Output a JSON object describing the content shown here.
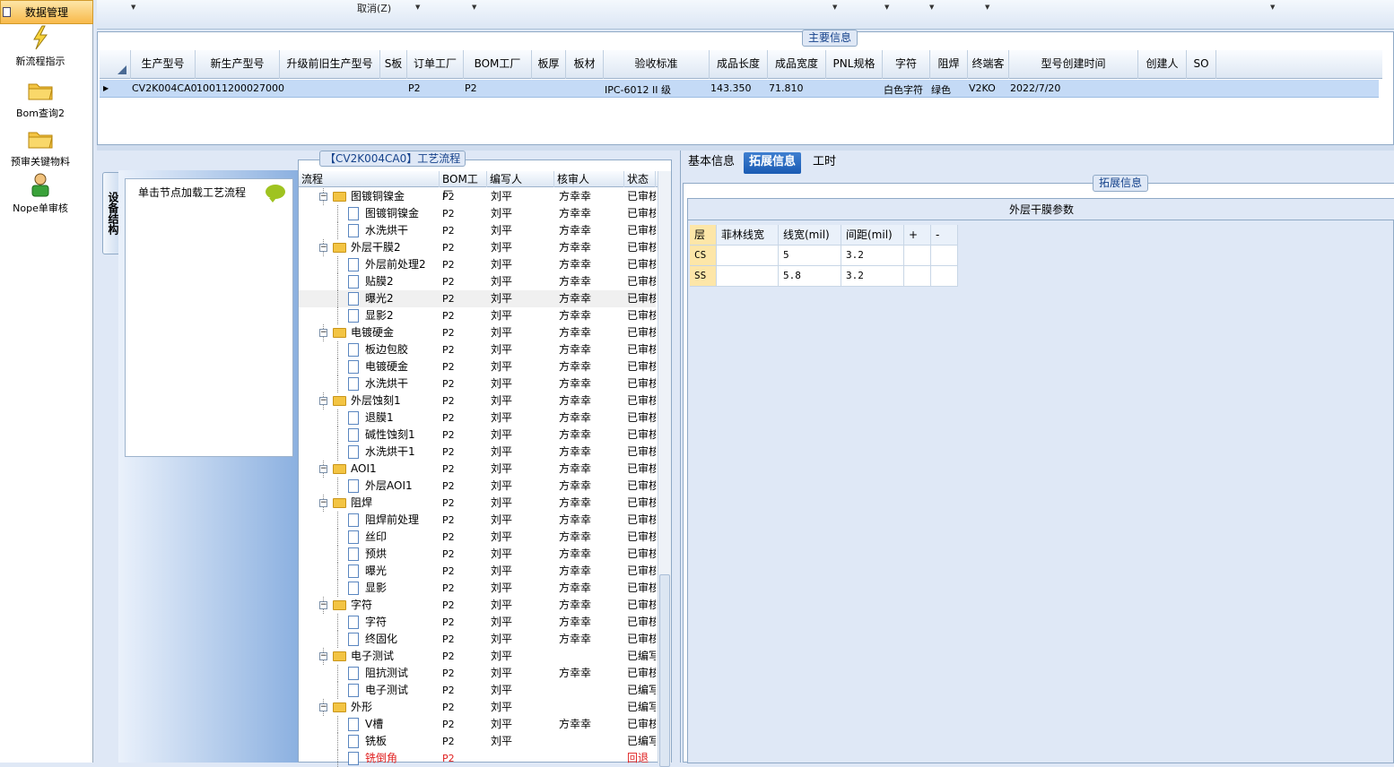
{
  "nav": {
    "header": "数据管理",
    "items": [
      {
        "label": "新流程指示",
        "icon": "lightning-icon"
      },
      {
        "label": "Bom查询2",
        "icon": "folder-icon"
      },
      {
        "label": "预审关键物料",
        "icon": "folder-icon"
      },
      {
        "label": "Nope单审核",
        "icon": "user-icon"
      }
    ]
  },
  "toolbar": {
    "cancel_label": "取消(Z)"
  },
  "main_info": {
    "title": "主要信息",
    "columns": [
      "生产型号",
      "新生产型号",
      "升级前旧生产型号",
      "S板",
      "订单工厂",
      "BOM工厂",
      "板厚",
      "板材",
      "验收标准",
      "成品长度",
      "成品宽度",
      "PNL规格",
      "字符",
      "阻焊",
      "终端客户代码",
      "型号创建时间",
      "创建人",
      "SO"
    ],
    "row": [
      "CV2K004CA0",
      "10011200027000",
      "",
      "",
      "P2",
      "P2",
      "",
      "",
      "IPC-6012 II 级",
      "143.350",
      "71.810",
      "",
      "白色字符",
      "绿色",
      "V2KO",
      "2022/7/20",
      "",
      ""
    ]
  },
  "flow": {
    "title": "【CV2K004CA0】工艺流程",
    "vtab_label": "设备结构",
    "load_hint": "单击节点加载工艺流程",
    "columns": [
      "流程",
      "BOM工厂",
      "编写人",
      "核审人",
      "状态"
    ],
    "rows": [
      {
        "name": "图镀铜镍金",
        "type": "folder",
        "bom": "P2",
        "author": "刘平",
        "reviewer": "方幸幸",
        "status": "已审核"
      },
      {
        "name": "图镀铜镍金",
        "type": "doc",
        "bom": "P2",
        "author": "刘平",
        "reviewer": "方幸幸",
        "status": "已审核"
      },
      {
        "name": "水洗烘干",
        "type": "doc",
        "bom": "P2",
        "author": "刘平",
        "reviewer": "方幸幸",
        "status": "已审核"
      },
      {
        "name": "外层干膜2",
        "type": "folder",
        "bom": "P2",
        "author": "刘平",
        "reviewer": "方幸幸",
        "status": "已审核"
      },
      {
        "name": "外层前处理2",
        "type": "doc",
        "bom": "P2",
        "author": "刘平",
        "reviewer": "方幸幸",
        "status": "已审核"
      },
      {
        "name": "贴膜2",
        "type": "doc",
        "bom": "P2",
        "author": "刘平",
        "reviewer": "方幸幸",
        "status": "已审核"
      },
      {
        "name": "曝光2",
        "type": "doc",
        "bom": "P2",
        "author": "刘平",
        "reviewer": "方幸幸",
        "status": "已审核",
        "selected": true
      },
      {
        "name": "显影2",
        "type": "doc",
        "bom": "P2",
        "author": "刘平",
        "reviewer": "方幸幸",
        "status": "已审核"
      },
      {
        "name": "电镀硬金",
        "type": "folder",
        "bom": "P2",
        "author": "刘平",
        "reviewer": "方幸幸",
        "status": "已审核"
      },
      {
        "name": "板边包胶",
        "type": "doc",
        "bom": "P2",
        "author": "刘平",
        "reviewer": "方幸幸",
        "status": "已审核"
      },
      {
        "name": "电镀硬金",
        "type": "doc",
        "bom": "P2",
        "author": "刘平",
        "reviewer": "方幸幸",
        "status": "已审核"
      },
      {
        "name": "水洗烘干",
        "type": "doc",
        "bom": "P2",
        "author": "刘平",
        "reviewer": "方幸幸",
        "status": "已审核"
      },
      {
        "name": "外层蚀刻1",
        "type": "folder",
        "bom": "P2",
        "author": "刘平",
        "reviewer": "方幸幸",
        "status": "已审核"
      },
      {
        "name": "退膜1",
        "type": "doc",
        "bom": "P2",
        "author": "刘平",
        "reviewer": "方幸幸",
        "status": "已审核"
      },
      {
        "name": "碱性蚀刻1",
        "type": "doc",
        "bom": "P2",
        "author": "刘平",
        "reviewer": "方幸幸",
        "status": "已审核"
      },
      {
        "name": "水洗烘干1",
        "type": "doc",
        "bom": "P2",
        "author": "刘平",
        "reviewer": "方幸幸",
        "status": "已审核"
      },
      {
        "name": "AOI1",
        "type": "folder",
        "bom": "P2",
        "author": "刘平",
        "reviewer": "方幸幸",
        "status": "已审核"
      },
      {
        "name": "外层AOI1",
        "type": "doc",
        "bom": "P2",
        "author": "刘平",
        "reviewer": "方幸幸",
        "status": "已审核"
      },
      {
        "name": "阻焊",
        "type": "folder",
        "bom": "P2",
        "author": "刘平",
        "reviewer": "方幸幸",
        "status": "已审核"
      },
      {
        "name": "阻焊前处理",
        "type": "doc",
        "bom": "P2",
        "author": "刘平",
        "reviewer": "方幸幸",
        "status": "已审核"
      },
      {
        "name": "丝印",
        "type": "doc",
        "bom": "P2",
        "author": "刘平",
        "reviewer": "方幸幸",
        "status": "已审核"
      },
      {
        "name": "预烘",
        "type": "doc",
        "bom": "P2",
        "author": "刘平",
        "reviewer": "方幸幸",
        "status": "已审核"
      },
      {
        "name": "曝光",
        "type": "doc",
        "bom": "P2",
        "author": "刘平",
        "reviewer": "方幸幸",
        "status": "已审核"
      },
      {
        "name": "显影",
        "type": "doc",
        "bom": "P2",
        "author": "刘平",
        "reviewer": "方幸幸",
        "status": "已审核"
      },
      {
        "name": "字符",
        "type": "folder",
        "bom": "P2",
        "author": "刘平",
        "reviewer": "方幸幸",
        "status": "已审核"
      },
      {
        "name": "字符",
        "type": "doc",
        "bom": "P2",
        "author": "刘平",
        "reviewer": "方幸幸",
        "status": "已审核"
      },
      {
        "name": "终固化",
        "type": "doc",
        "bom": "P2",
        "author": "刘平",
        "reviewer": "方幸幸",
        "status": "已审核"
      },
      {
        "name": "电子测试",
        "type": "folder",
        "bom": "P2",
        "author": "刘平",
        "reviewer": "",
        "status": "已编写"
      },
      {
        "name": "阻抗测试",
        "type": "doc",
        "bom": "P2",
        "author": "刘平",
        "reviewer": "方幸幸",
        "status": "已审核"
      },
      {
        "name": "电子测试",
        "type": "doc",
        "bom": "P2",
        "author": "刘平",
        "reviewer": "",
        "status": "已编写"
      },
      {
        "name": "外形",
        "type": "folder",
        "bom": "P2",
        "author": "刘平",
        "reviewer": "",
        "status": "已编写"
      },
      {
        "name": "V槽",
        "type": "doc",
        "bom": "P2",
        "author": "刘平",
        "reviewer": "方幸幸",
        "status": "已审核"
      },
      {
        "name": "铣板",
        "type": "doc",
        "bom": "P2",
        "author": "刘平",
        "reviewer": "",
        "status": "已编写"
      },
      {
        "name": "铣倒角",
        "type": "doc",
        "bom": "P2",
        "author": "",
        "reviewer": "",
        "status": "回退",
        "red": true
      }
    ]
  },
  "tabs": [
    "基本信息",
    "拓展信息",
    "工时"
  ],
  "ext": {
    "title": "拓展信息",
    "table_title": "外层干膜参数",
    "columns": [
      "层",
      "菲林线宽",
      "线宽(mil)",
      "间距(mil)",
      "+",
      "-"
    ],
    "rows": [
      [
        "CS",
        "",
        "5",
        "3.2",
        "",
        ""
      ],
      [
        "SS",
        "",
        "5.8",
        "3.2",
        "",
        ""
      ]
    ]
  },
  "colors": {
    "accent": "#1a5bb3",
    "selected_row": "#c4daf6",
    "nav_header": "#f8b94a"
  }
}
